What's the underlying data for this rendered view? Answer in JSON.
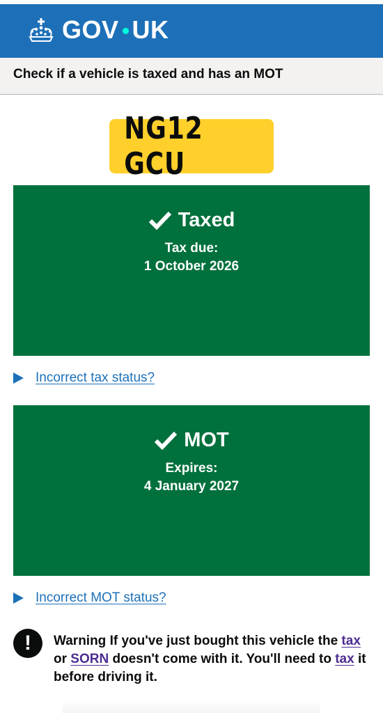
{
  "header": {
    "logo_left": "GOV",
    "logo_right": "UK",
    "logo_icon": "crown-icon",
    "brand_color": "#1d70b8",
    "accent_color": "#00ffe0"
  },
  "service": {
    "name": "Check if a vehicle is taxed and has an MOT"
  },
  "vehicle": {
    "registration": "NG12 GCU",
    "plate_color": "#ffd02b"
  },
  "tax": {
    "status": "Taxed",
    "label": "Tax due:",
    "date": "1 October 2026",
    "panel_color": "#00703c",
    "details_link": "Incorrect tax status?"
  },
  "mot": {
    "status": "MOT",
    "label": "Expires:",
    "date": "4 January 2027",
    "panel_color": "#00703c",
    "details_link": "Incorrect MOT status?"
  },
  "warning": {
    "icon": "!",
    "hidden_prefix": "Warning",
    "text_1": "If you've just bought this vehicle the",
    "link_tax_1": "tax",
    "text_2": "or",
    "link_sorn": "SORN",
    "text_3": "doesn't come with it. You'll need to",
    "link_tax_2": "tax",
    "text_4": "it before driving it.",
    "link_visited_color": "#4c2c92"
  }
}
